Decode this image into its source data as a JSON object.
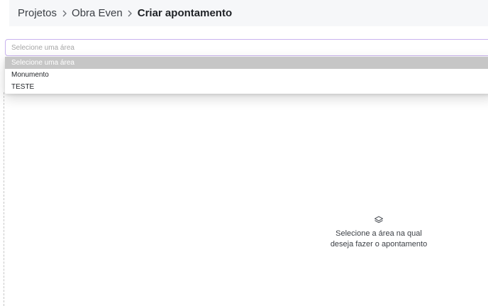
{
  "breadcrumb": {
    "items": [
      "Projetos",
      "Obra Even"
    ],
    "current": "Criar apontamento"
  },
  "area_select": {
    "placeholder": "Selecione uma área",
    "options": [
      "Selecione uma área",
      "Monumento",
      "TESTE"
    ],
    "highlighted_index": 0
  },
  "empty_state": {
    "icon": "layers-icon",
    "line1": "Selecione a área na qual",
    "line2": "deseja fazer o apontamento"
  }
}
